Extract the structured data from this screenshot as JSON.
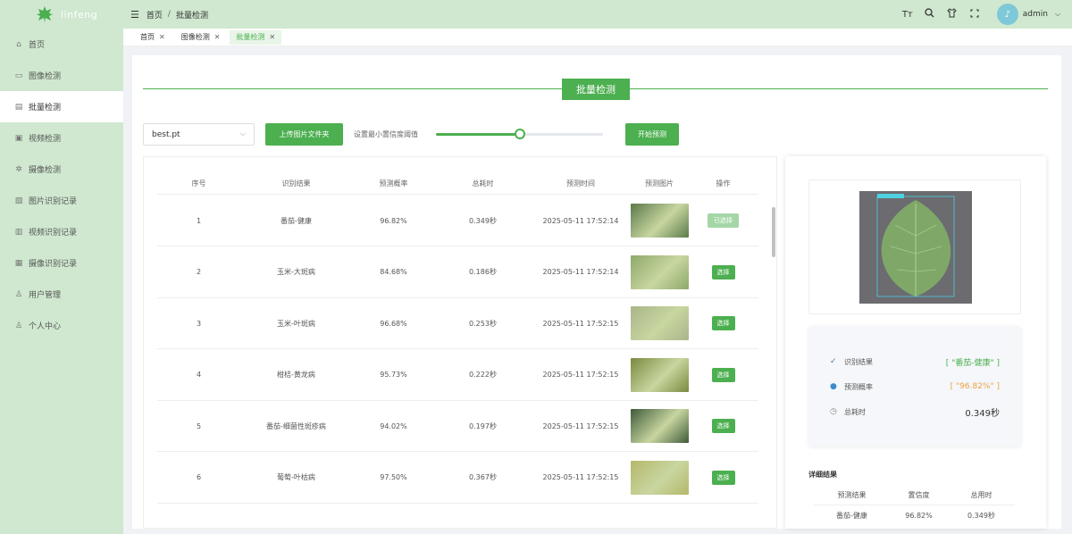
{
  "app": {
    "name": "linfeng"
  },
  "sidebar": {
    "items": [
      {
        "label": "首页",
        "icon": "home-icon"
      },
      {
        "label": "图像检测",
        "icon": "image-icon"
      },
      {
        "label": "批量检测",
        "icon": "batch-icon",
        "active": true
      },
      {
        "label": "视频检测",
        "icon": "video-icon"
      },
      {
        "label": "摄像检测",
        "icon": "camera-icon"
      },
      {
        "label": "图片识别记录",
        "icon": "image-record-icon"
      },
      {
        "label": "视频识别记录",
        "icon": "video-record-icon"
      },
      {
        "label": "摄像识别记录",
        "icon": "camera-record-icon"
      },
      {
        "label": "用户管理",
        "icon": "user-manage-icon"
      },
      {
        "label": "个人中心",
        "icon": "profile-icon"
      }
    ]
  },
  "header": {
    "breadcrumb": [
      "首页",
      "批量检测"
    ],
    "username": "admin",
    "icons": [
      "font-size-icon",
      "search-icon",
      "theme-shirt-icon",
      "fullscreen-icon"
    ]
  },
  "tabs": [
    {
      "label": "首页"
    },
    {
      "label": "图像检测"
    },
    {
      "label": "批量检测",
      "active": true
    }
  ],
  "page": {
    "title": "批量检测",
    "model_select": "best.pt",
    "upload_button": "上传图片文件夹",
    "threshold_label": "设置最小置信度阈值",
    "threshold_value": 0.5,
    "start_button": "开始预测"
  },
  "table": {
    "headers": [
      "序号",
      "识别结果",
      "预测概率",
      "总耗时",
      "预测时间",
      "预测图片",
      "操作"
    ],
    "rows": [
      {
        "index": "1",
        "result": "番茄-健康",
        "prob": "96.82%",
        "time": "0.349秒",
        "date": "2025-05-11 17:52:14",
        "action": "已选择",
        "selected": true,
        "thumb": "#5b7a4a"
      },
      {
        "index": "2",
        "result": "玉米-大斑病",
        "prob": "84.68%",
        "time": "0.186秒",
        "date": "2025-05-11 17:52:14",
        "action": "选择",
        "selected": false,
        "thumb": "#8ea86a"
      },
      {
        "index": "3",
        "result": "玉米-叶斑病",
        "prob": "96.68%",
        "time": "0.253秒",
        "date": "2025-05-11 17:52:15",
        "action": "选择",
        "selected": false,
        "thumb": "#a9b58a"
      },
      {
        "index": "4",
        "result": "柑桔-黄龙病",
        "prob": "95.73%",
        "time": "0.222秒",
        "date": "2025-05-11 17:52:15",
        "action": "选择",
        "selected": false,
        "thumb": "#7a8a3e"
      },
      {
        "index": "5",
        "result": "番茄-细菌性斑疹病",
        "prob": "94.02%",
        "time": "0.197秒",
        "date": "2025-05-11 17:52:15",
        "action": "选择",
        "selected": false,
        "thumb": "#3f5a3a"
      },
      {
        "index": "6",
        "result": "葡萄-叶枯病",
        "prob": "97.50%",
        "time": "0.367秒",
        "date": "2025-05-11 17:52:15",
        "action": "选择",
        "selected": false,
        "thumb": "#b5b86a"
      }
    ]
  },
  "result": {
    "label_result": "识别结果",
    "value_result": "[ \"番茄-健康\" ]",
    "label_prob": "预测概率",
    "value_prob": "[ \"96.82%\" ]",
    "label_time": "总耗时",
    "value_time": "0.349秒",
    "color_result": "#4caf50",
    "color_prob": "#f0a040"
  },
  "detail": {
    "title": "详细结果",
    "headers": [
      "预测结果",
      "置信度",
      "总用时"
    ],
    "row": [
      "番茄-健康",
      "96.82%",
      "0.349秒"
    ]
  },
  "colors": {
    "accent": "#4caf50",
    "sidebar_bg": "#cfe8cf"
  }
}
